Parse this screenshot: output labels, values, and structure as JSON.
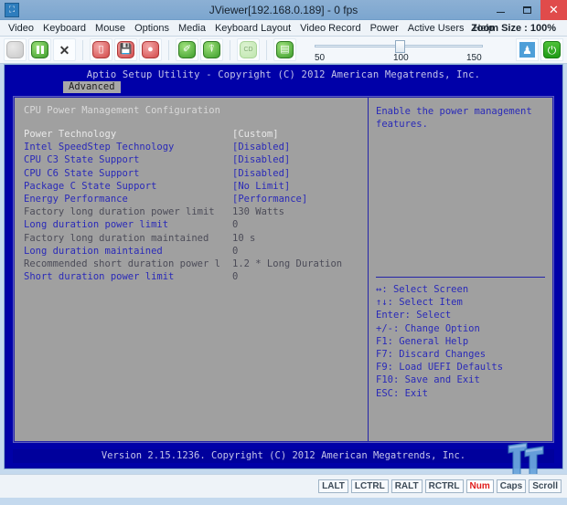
{
  "window": {
    "title": "JViewer[192.168.0.189] - 0 fps",
    "app_icon": "jviewer-icon",
    "minimize": "–",
    "maximize": "▭",
    "close": "×"
  },
  "menubar": {
    "items": [
      "Video",
      "Keyboard",
      "Mouse",
      "Options",
      "Media",
      "Keyboard Layout",
      "Video Record",
      "Power",
      "Active Users",
      "Help"
    ],
    "zoom_label": "Zoom Size : 100%"
  },
  "toolbar": {
    "buttons": [
      {
        "name": "refresh-button",
        "glyph": "",
        "style": "g-grey"
      },
      {
        "name": "pause-button",
        "glyph": "▐▐",
        "style": "g-green"
      },
      {
        "name": "fullscreen-button",
        "glyph": "✖",
        "style": "g-x"
      },
      {
        "name": "stop-record-button",
        "glyph": "",
        "style": "g-red"
      },
      {
        "name": "save-snapshot-button",
        "glyph": "■",
        "style": "g-red"
      },
      {
        "name": "record-button",
        "glyph": "●",
        "style": "g-red"
      },
      {
        "name": "mouse-mode-button",
        "glyph": "✐",
        "style": "g-green"
      },
      {
        "name": "virtual-keyboard-button",
        "glyph": "⌸",
        "style": "g-green"
      },
      {
        "name": "cd-media-button",
        "glyph": "CD",
        "style": "g-greenlite"
      },
      {
        "name": "hotkeys-button",
        "glyph": "☰",
        "style": "g-green"
      }
    ],
    "slider": {
      "value": 100,
      "ticks": [
        "50",
        "100",
        "150"
      ]
    },
    "user_button": "♟",
    "power_button": "⏻"
  },
  "bios": {
    "header": "Aptio Setup Utility - Copyright (C) 2012 American Megatrends, Inc.",
    "tab": "Advanced",
    "section_title": "CPU Power Management Configuration",
    "settings": [
      {
        "label": "Power Technology",
        "value": "[Custom]",
        "label_class": "c-sel",
        "value_class": "c-sel"
      },
      {
        "label": "Intel SpeedStep Technology",
        "value": "[Disabled]",
        "label_class": "c-opt",
        "value_class": "c-opt"
      },
      {
        "label": "CPU C3 State Support",
        "value": "[Disabled]",
        "label_class": "c-opt",
        "value_class": "c-opt"
      },
      {
        "label": "CPU C6 State Support",
        "value": "[Disabled]",
        "label_class": "c-opt",
        "value_class": "c-opt"
      },
      {
        "label": "Package C State Support",
        "value": "[No Limit]",
        "label_class": "c-opt",
        "value_class": "c-opt"
      },
      {
        "label": "Energy Performance",
        "value": "[Performance]",
        "label_class": "c-opt",
        "value_class": "c-opt"
      },
      {
        "label": "Factory long duration power limit",
        "value": "130 Watts",
        "label_class": "c-ro",
        "value_class": "c-ro"
      },
      {
        "label": "Long duration power limit",
        "value": "0",
        "label_class": "c-opt",
        "value_class": "c-ro"
      },
      {
        "label": "Factory long duration maintained",
        "value": "10 s",
        "label_class": "c-ro",
        "value_class": "c-ro"
      },
      {
        "label": "Long duration maintained",
        "value": "0",
        "label_class": "c-opt",
        "value_class": "c-ro"
      },
      {
        "label": "Recommended short duration power l",
        "value": "1.2 * Long Duration",
        "label_class": "c-ro",
        "value_class": "c-ro"
      },
      {
        "label": "Short duration power limit",
        "value": "0",
        "label_class": "c-opt",
        "value_class": "c-ro"
      }
    ],
    "help_text": "Enable the power management\nfeatures.",
    "keys": [
      "↔: Select Screen",
      "↑↓: Select Item",
      "Enter: Select",
      "+/-: Change Option",
      "F1: General Help",
      "F7: Discard Changes",
      "F9: Load UEFI Defaults",
      "F10: Save and Exit",
      "ESC: Exit"
    ],
    "footer": "Version 2.15.1236. Copyright (C) 2012 American Megatrends, Inc."
  },
  "statusbar": {
    "leds": [
      {
        "label": "LALT",
        "active": false
      },
      {
        "label": "LCTRL",
        "active": false
      },
      {
        "label": "RALT",
        "active": false
      },
      {
        "label": "RCTRL",
        "active": false
      },
      {
        "label": "Num",
        "active": true
      },
      {
        "label": "Caps",
        "active": false
      },
      {
        "label": "Scroll",
        "active": false
      }
    ]
  },
  "colors": {
    "bios_bg": "#0000a8",
    "panel_bg": "#a0a0a0",
    "option_blue": "#2a2ab8",
    "readonly_gray": "#4c4c58",
    "selected": "#e8e8e8",
    "accent": "#4e9fd8"
  }
}
